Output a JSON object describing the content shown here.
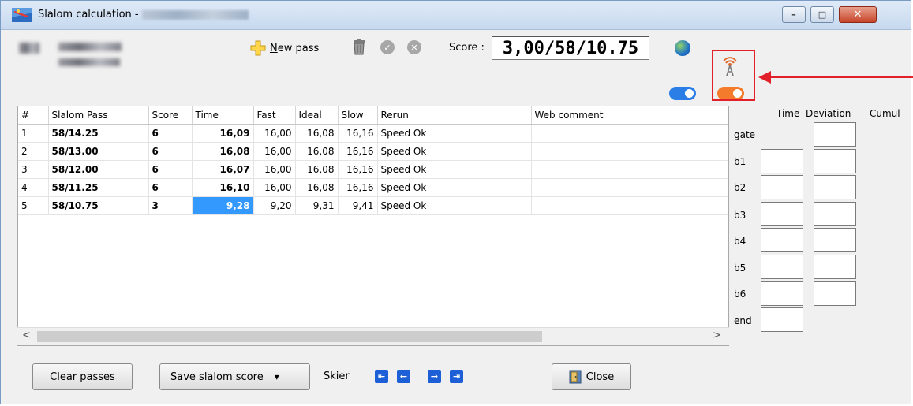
{
  "window": {
    "title": "Slalom calculation -",
    "minimize_glyph": "–",
    "maximize_glyph": "□",
    "close_glyph": "✕"
  },
  "toolbar": {
    "new_pass_underline": "N",
    "new_pass_rest": "ew pass",
    "score_label": "Score :",
    "score_value": "3,00/58/10.75"
  },
  "table": {
    "columns": [
      "#",
      "Slalom Pass",
      "Score",
      "Time",
      "Fast",
      "Ideal",
      "Slow",
      "Rerun",
      "Web comment"
    ],
    "rows": [
      {
        "num": "1",
        "pass": "58/14.25",
        "score": "6",
        "time": "16,09",
        "fast": "16,00",
        "ideal": "16,08",
        "slow": "16,16",
        "rerun": "Speed Ok",
        "comment": ""
      },
      {
        "num": "2",
        "pass": "58/13.00",
        "score": "6",
        "time": "16,08",
        "fast": "16,00",
        "ideal": "16,08",
        "slow": "16,16",
        "rerun": "Speed Ok",
        "comment": ""
      },
      {
        "num": "3",
        "pass": "58/12.00",
        "score": "6",
        "time": "16,07",
        "fast": "16,00",
        "ideal": "16,08",
        "slow": "16,16",
        "rerun": "Speed Ok",
        "comment": ""
      },
      {
        "num": "4",
        "pass": "58/11.25",
        "score": "6",
        "time": "16,10",
        "fast": "16,00",
        "ideal": "16,08",
        "slow": "16,16",
        "rerun": "Speed Ok",
        "comment": ""
      },
      {
        "num": "5",
        "pass": "58/10.75",
        "score": "3",
        "time": "9,28",
        "fast": "9,20",
        "ideal": "9,31",
        "slow": "9,41",
        "rerun": "Speed Ok",
        "comment": ""
      }
    ],
    "scroll_left": "<",
    "scroll_right": ">"
  },
  "side_panel": {
    "headers": {
      "time": "Time",
      "deviation": "Deviation",
      "cumul": "Cumul"
    },
    "labels": [
      "gate",
      "b1",
      "b2",
      "b3",
      "b4",
      "b5",
      "b6",
      "end"
    ]
  },
  "footer": {
    "clear_label": "Clear passes",
    "save_label": "Save slalom score",
    "save_arrow": "▾",
    "skier_label": "Skier",
    "close_label": "Close"
  },
  "colors": {
    "selected_cell": "#3399ff",
    "toggle_blue": "#2a7ee6",
    "toggle_orange": "#f47a2c",
    "highlight_red": "#e2202a"
  }
}
